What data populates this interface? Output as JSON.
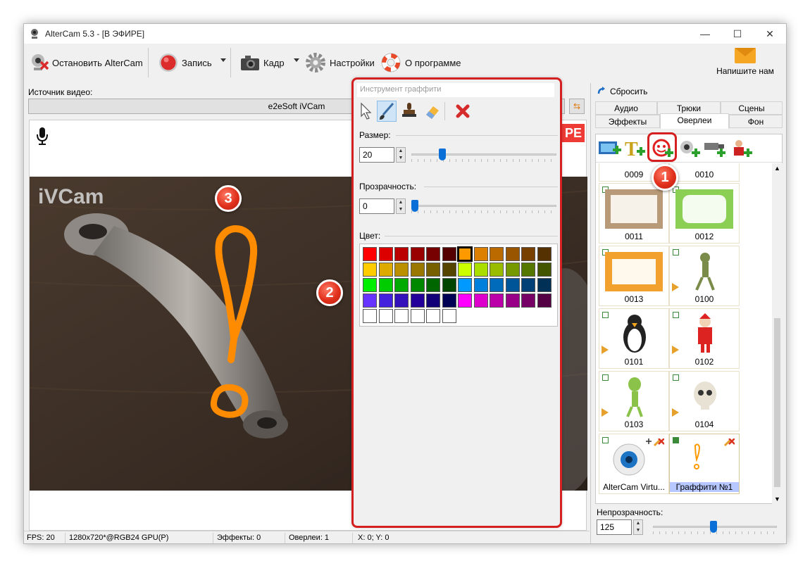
{
  "window": {
    "title": "AlterCam 5.3 - [В ЭФИРЕ]"
  },
  "toolbar": {
    "stop_label": "Остановить AlterCam",
    "record_label": "Запись",
    "frame_label": "Кадр",
    "settings_label": "Настройки",
    "about_label": "О программе",
    "mail_label": "Напишите нам"
  },
  "source": {
    "label": "Источник видео:",
    "selected": "e2eSoft iVCam"
  },
  "preview": {
    "live_badge": "РЕ",
    "watermark": "iVCam"
  },
  "graffiti": {
    "title": "Инструмент граффити",
    "size_label": "Размер:",
    "size_value": "20",
    "size_level": 0.2,
    "opacity_label": "Прозрачность:",
    "opacity_value": "0",
    "opacity_level": 0.0,
    "color_label": "Цвет:",
    "selected_color": "#ff9900",
    "palette": [
      [
        "#ff0000",
        "#dd0000",
        "#bb0000",
        "#990000",
        "#770000",
        "#550000",
        "#ff9900",
        "#dd8000",
        "#bb6a00",
        "#995500",
        "#774000",
        "#553000"
      ],
      [
        "#ffcc00",
        "#ddaa00",
        "#bb9000",
        "#997700",
        "#776000",
        "#554400",
        "#ccff00",
        "#aadd00",
        "#99bb00",
        "#779900",
        "#557700",
        "#445500"
      ],
      [
        "#00ee00",
        "#00cc00",
        "#00aa00",
        "#008800",
        "#006600",
        "#004400",
        "#0099ff",
        "#0080dd",
        "#006abb",
        "#005599",
        "#004077",
        "#003055"
      ],
      [
        "#6633ff",
        "#4422dd",
        "#3311bb",
        "#220099",
        "#110077",
        "#000055",
        "#ff00ff",
        "#dd00cc",
        "#bb00aa",
        "#990088",
        "#770066",
        "#550044"
      ],
      [
        "#ffffff",
        "#ffffff",
        "#ffffff",
        "#ffffff",
        "#ffffff",
        "#ffffff"
      ]
    ]
  },
  "status": {
    "fps": "FPS: 20",
    "resolution": "1280x720*@RGB24 GPU(P)",
    "effects": "Эффекты: 0",
    "overlays": "Оверлеи: 1",
    "coords": "X: 0; Y: 0"
  },
  "right": {
    "reset_label": "Сбросить",
    "tabs_row1": [
      "Аудио",
      "Трюки",
      "Сцены"
    ],
    "tabs_row2": [
      "Эффекты",
      "Оверлеи",
      "Фон"
    ],
    "active_tab": "Оверлеи",
    "tiles": [
      {
        "caption": "0009"
      },
      {
        "caption": "0010"
      },
      {
        "caption": "0011"
      },
      {
        "caption": "0012"
      },
      {
        "caption": "0013"
      },
      {
        "caption": "0100"
      },
      {
        "caption": "0101"
      },
      {
        "caption": "0102"
      },
      {
        "caption": "0103"
      },
      {
        "caption": "0104"
      },
      {
        "caption": "AlterCam Virtu..."
      },
      {
        "caption": "Граффити №1"
      }
    ],
    "opacity_label": "Непрозрачность:",
    "opacity_value": "125",
    "opacity_level": 0.49
  },
  "annotations": {
    "badge1": "1",
    "badge2": "2",
    "badge3": "3"
  },
  "colors": {
    "accent_red": "#d42020",
    "graffiti_orange": "#ff9900",
    "selected_blue": "#b7c7ff"
  }
}
